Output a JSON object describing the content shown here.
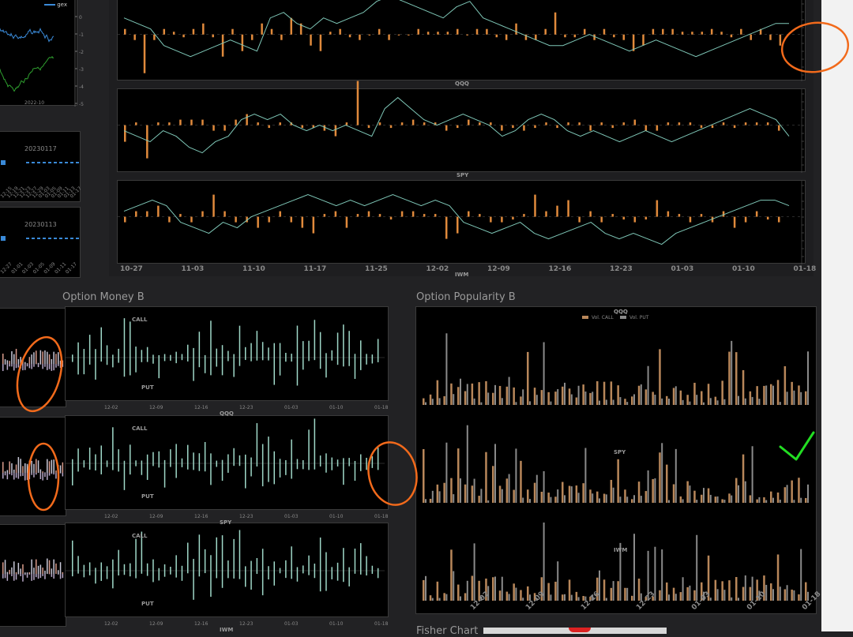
{
  "colors": {
    "orange": "#e08a3c",
    "teal": "#9fd8c8",
    "line": "#7fc8b8",
    "blue": "#3a8ad8",
    "green": "#2fa02f",
    "annot_orange": "#f26a1b",
    "annot_green": "#22dd22",
    "bar_call": "#b8875a",
    "bar_put": "#8a8a8a"
  },
  "top_left_inset": {
    "legend": "gex",
    "ytick_labels": [
      "0",
      "-1",
      "-2",
      "-3",
      "-4",
      "-5"
    ],
    "xtick": "2022-10"
  },
  "left_date_panels": {
    "labels": [
      "20230117",
      "20230113"
    ],
    "xticks_1": [
      "12-15",
      "12-19",
      "12-21",
      "12-23",
      "12-27",
      "12-29",
      "01-03",
      "01-05",
      "01-09",
      "01-11",
      "01-13",
      "01-17"
    ],
    "xticks_2": [
      "12-27",
      "01-01",
      "01-03",
      "01-05",
      "01-09",
      "01-11",
      "01-17"
    ]
  },
  "main_top": {
    "xticks": [
      "10-27",
      "11-03",
      "11-10",
      "11-17",
      "11-25",
      "12-02",
      "12-09",
      "12-16",
      "12-23",
      "01-03",
      "01-10",
      "01-18"
    ],
    "panel_labels": [
      "QQQ",
      "SPY",
      "IWM"
    ]
  },
  "option_money_b": {
    "title": "Option Money B",
    "xticks": [
      "12-02",
      "12-09",
      "12-16",
      "12-23",
      "01-03",
      "01-10",
      "01-18"
    ],
    "panel_labels": [
      "QQQ",
      "SPY",
      "IWM"
    ],
    "call_label": "CALL",
    "put_label": "PUT"
  },
  "option_popularity_b": {
    "title": "Option Popularity B",
    "panel_labels": [
      "QQQ",
      "SPY",
      "IWM"
    ],
    "legend": [
      "Vol. CALL",
      "Vol. PUT"
    ],
    "xticks": [
      "12-02",
      "12-09",
      "12-16",
      "12-23",
      "01-03",
      "01-10",
      "01-18"
    ]
  },
  "fisher_chart": {
    "title": "Fisher Chart"
  },
  "chart_data": [
    {
      "type": "bar",
      "title": "QQQ",
      "series": [
        {
          "name": "bars",
          "values": [
            1,
            -1,
            -7,
            -1,
            1,
            0.5,
            -0.5,
            1,
            2,
            -0.5,
            -4,
            1,
            -3,
            -1,
            2,
            1,
            -1,
            3,
            2,
            -2,
            -3,
            0.5,
            1,
            -0.5,
            -1,
            0,
            1,
            -1,
            0,
            0,
            1,
            0.5,
            0.5,
            0.5,
            1,
            0,
            1,
            1,
            -0.5,
            -1,
            2,
            -1,
            -1,
            1,
            4,
            -0.5,
            -0.5,
            1,
            -1,
            1,
            -0.5,
            -1,
            -3,
            -2,
            1,
            1,
            1,
            0.5,
            0.5,
            0.5,
            1,
            0.5,
            -0.5,
            1,
            -1,
            1,
            -1,
            -2
          ]
        },
        {
          "name": "line",
          "values": [
            3,
            2,
            1,
            -2,
            -3,
            -4,
            -3,
            -2,
            -1,
            -2,
            -3,
            3,
            4,
            2,
            1,
            3,
            2,
            3,
            4,
            6,
            7,
            6,
            5,
            4,
            3,
            5,
            6,
            3,
            2,
            1,
            0,
            -1,
            -2,
            -2,
            -1,
            0,
            -1,
            -2,
            -3,
            -2,
            -1,
            -2,
            -3,
            -4,
            -3,
            -2,
            -1,
            0,
            1,
            2,
            2
          ]
        }
      ]
    },
    {
      "type": "bar",
      "title": "SPY",
      "series": [
        {
          "name": "bars",
          "values": [
            -3,
            0.5,
            -6,
            0.5,
            0.5,
            1,
            1,
            1,
            -1,
            -1,
            1,
            2,
            0.5,
            -0.5,
            0.5,
            0.5,
            -0.5,
            -0.5,
            -1,
            -2,
            0.5,
            8,
            -0.5,
            0.5,
            -0.5,
            0.5,
            1,
            0.5,
            0.5,
            -1,
            -0.5,
            1,
            0.5,
            0.5,
            -1,
            -0.5,
            -1,
            -0.5,
            0.5,
            -0.5,
            0.5,
            0.5,
            -1,
            0.5,
            -0.5,
            0.5,
            1,
            -1,
            -1,
            0.5,
            0.5,
            0.5,
            -0.5,
            -0.5,
            0.5,
            -0.5,
            0.5,
            0.5,
            0.5,
            -1
          ]
        },
        {
          "name": "line",
          "values": [
            -1,
            -2,
            -3,
            -1,
            -2,
            -4,
            -5,
            -3,
            -2,
            1,
            2,
            1,
            2,
            0,
            -1,
            0,
            -1,
            0,
            -1,
            -2,
            3,
            5,
            3,
            1,
            0,
            1,
            2,
            1,
            0,
            -2,
            -1,
            1,
            2,
            1,
            -1,
            -2,
            -1,
            -2,
            -3,
            -2,
            -1,
            -2,
            -3,
            -2,
            -1,
            0,
            1,
            2,
            3,
            2,
            1,
            -2
          ]
        }
      ]
    },
    {
      "type": "bar",
      "title": "IWM",
      "series": [
        {
          "name": "bars",
          "values": [
            -1,
            1,
            1,
            2,
            -1,
            0.5,
            -1,
            1,
            4,
            1,
            -1,
            -1,
            -2,
            -1,
            1,
            -1,
            -2,
            -3,
            0.5,
            1,
            -2,
            0.5,
            1,
            0.5,
            -0.5,
            1,
            1,
            0.5,
            0.5,
            -4,
            -3,
            1,
            0.5,
            -1,
            -1,
            -0.5,
            0.5,
            4,
            1,
            2,
            3,
            -1,
            1,
            -1,
            0.5,
            -0.5,
            -1,
            -0.5,
            3,
            1,
            0.5,
            -1,
            0.5,
            -1,
            1,
            -2,
            -1,
            1,
            -0.5,
            -1
          ]
        },
        {
          "name": "line",
          "values": [
            1,
            2,
            3,
            2,
            -1,
            -2,
            -3,
            -1,
            -2,
            0,
            1,
            2,
            3,
            4,
            3,
            2,
            3,
            2,
            3,
            4,
            3,
            2,
            3,
            2,
            -1,
            -2,
            -3,
            -2,
            -1,
            -3,
            -4,
            -3,
            -2,
            -1,
            -3,
            -4,
            -3,
            -4,
            -5,
            -3,
            -2,
            -1,
            0,
            1,
            2,
            3,
            3,
            2
          ]
        }
      ]
    }
  ]
}
